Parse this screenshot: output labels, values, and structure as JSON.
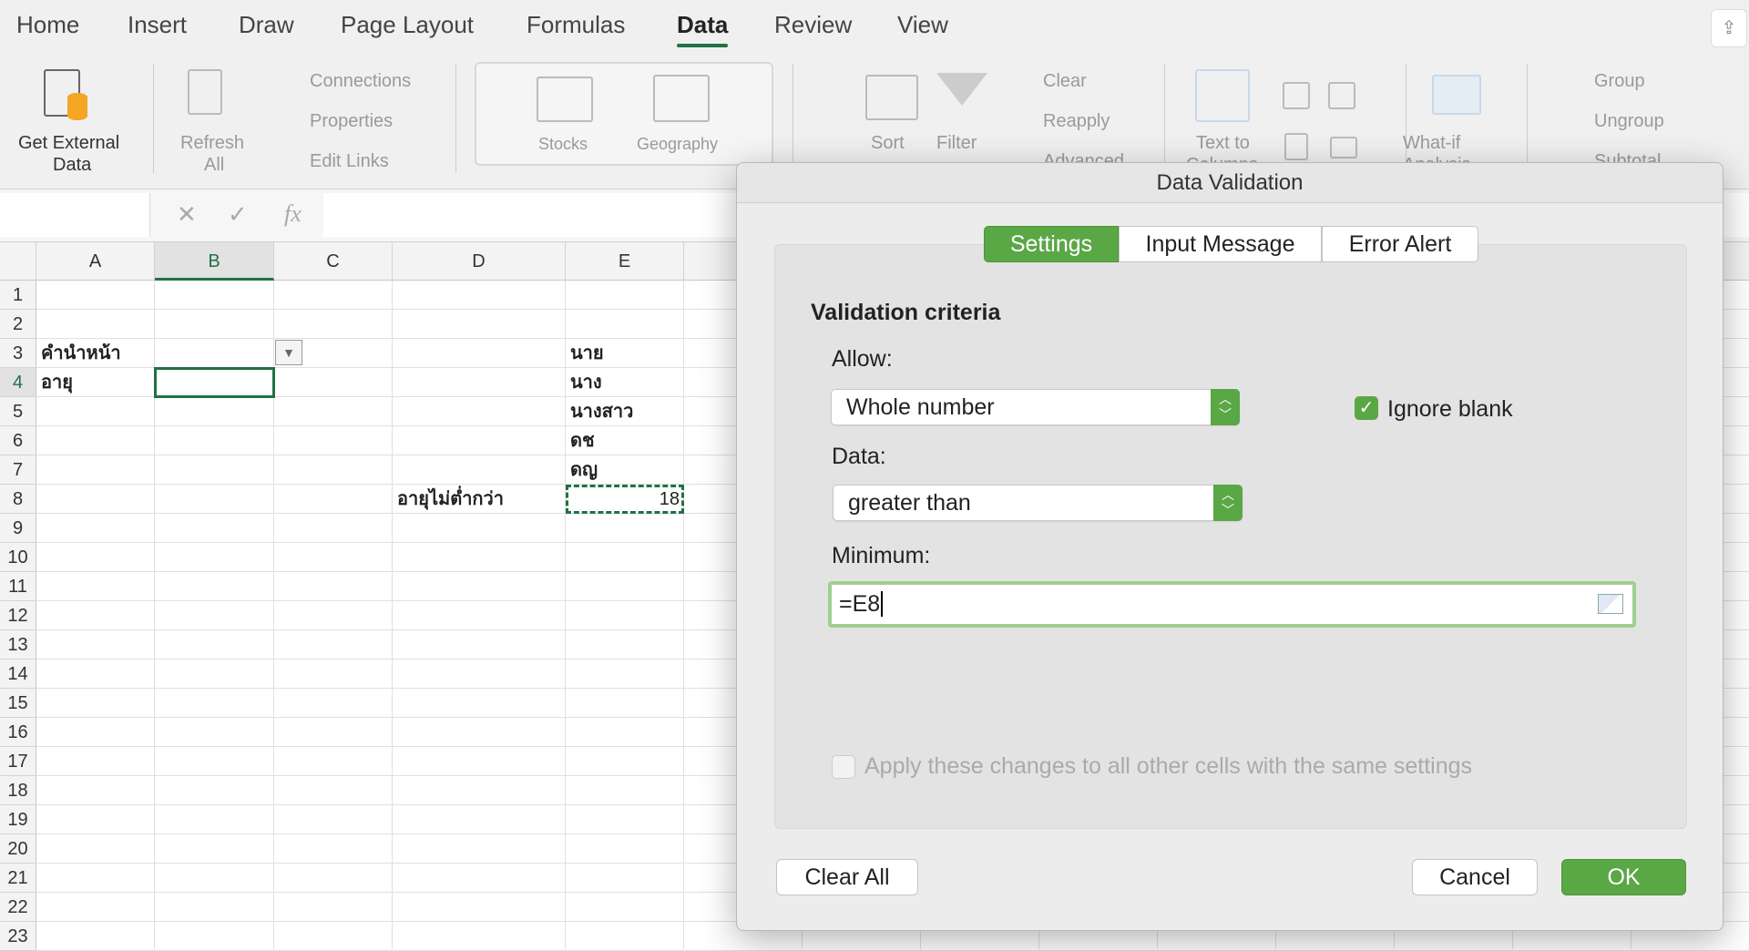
{
  "menu": {
    "tabs": [
      "Home",
      "Insert",
      "Draw",
      "Page Layout",
      "Formulas",
      "Data",
      "Review",
      "View"
    ],
    "active": "Data"
  },
  "ribbon": {
    "get_external": "Get External",
    "get_external2": "Data",
    "refresh": "Refresh",
    "refresh2": "All",
    "connections": "Connections",
    "properties": "Properties",
    "edit_links": "Edit Links",
    "stocks": "Stocks",
    "geography": "Geography",
    "sort": "Sort",
    "filter": "Filter",
    "clear": "Clear",
    "reapply": "Reapply",
    "advanced": "Advanced",
    "text_to": "Text to",
    "columns": "Columns",
    "whatif": "What-if",
    "analysis": "Analysis",
    "group": "Group",
    "ungroup": "Ungroup",
    "subtotal": "Subtotal"
  },
  "formula_bar": {
    "name_box": "",
    "fx": "fx",
    "cancel": "✕",
    "enter": "✓",
    "value": ""
  },
  "sheet": {
    "columns": [
      "A",
      "B",
      "C",
      "D",
      "E"
    ],
    "rows": [
      "1",
      "2",
      "3",
      "4",
      "5",
      "6",
      "7",
      "8",
      "9",
      "10",
      "11",
      "12",
      "13",
      "14",
      "15",
      "16",
      "17",
      "18",
      "19",
      "20",
      "21",
      "22",
      "23"
    ],
    "cells": {
      "A3": "คำนำหน้า",
      "A4": "อายุ",
      "E3": "นาย",
      "E4": "นาง",
      "E5": "นางสาว",
      "E6": "ดช",
      "E7": "ดญ",
      "D8": "อายุไม่ต่ำกว่า",
      "E8": "18"
    }
  },
  "dialog": {
    "title": "Data Validation",
    "tabs": [
      "Settings",
      "Input Message",
      "Error Alert"
    ],
    "active_tab": "Settings",
    "section": "Validation criteria",
    "allow_label": "Allow:",
    "allow_value": "Whole number",
    "ignore_blank": "Ignore blank",
    "ignore_blank_checked": true,
    "data_label": "Data:",
    "data_value": "greater than",
    "minimum_label": "Minimum:",
    "minimum_value": "=E8",
    "apply_all": "Apply these changes to all other cells with the same settings",
    "apply_all_checked": false,
    "clear_all": "Clear All",
    "cancel": "Cancel",
    "ok": "OK"
  },
  "colors": {
    "accent": "#5aa746",
    "excel_green": "#207245"
  }
}
